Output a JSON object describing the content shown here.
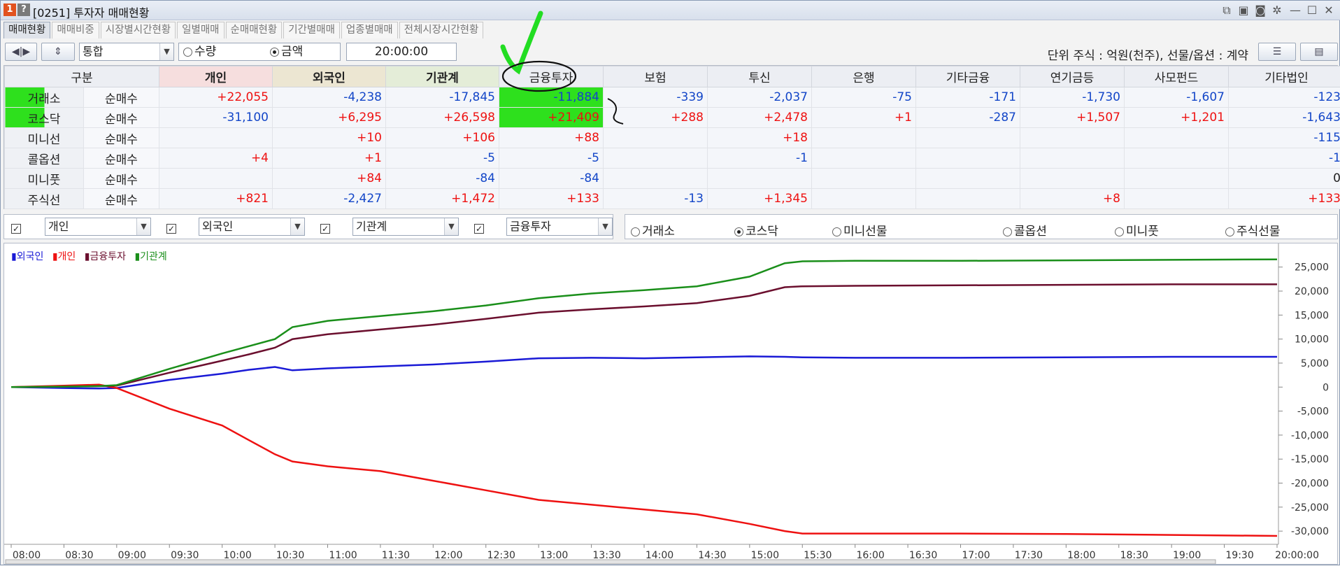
{
  "window": {
    "title": "[0251] 투자자 매매현황"
  },
  "tabs": [
    "매매현황",
    "매매비중",
    "시장별시간현황",
    "일별매매",
    "순매매현황",
    "기간별매매",
    "업종별매매",
    "전체시장시간현황"
  ],
  "toolbar": {
    "market_select": "통합",
    "radio_qty": "수량",
    "radio_amount": "금액",
    "time_value": "20:00:00",
    "unit_text": "단위 주식 : 억원(천주), 선물/옵션 : 계약"
  },
  "table": {
    "headers": [
      "구분",
      "",
      "개인",
      "외국인",
      "기관계",
      "금융투자",
      "보험",
      "투신",
      "은행",
      "기타금융",
      "연기금등",
      "사모펀드",
      "기타법인"
    ],
    "rows": [
      {
        "market": "거래소",
        "type": "순매수",
        "cells": [
          "+22,055",
          "-4,238",
          "-17,845",
          "-11,884",
          "-339",
          "-2,037",
          "-75",
          "-171",
          "-1,730",
          "-1,607",
          "-123"
        ]
      },
      {
        "market": "코스닥",
        "type": "순매수",
        "cells": [
          "-31,100",
          "+6,295",
          "+26,598",
          "+21,409",
          "+288",
          "+2,478",
          "+1",
          "-287",
          "+1,507",
          "+1,201",
          "-1,643"
        ]
      },
      {
        "market": "미니선",
        "type": "순매수",
        "cells": [
          "",
          "+10",
          "+106",
          "+88",
          "",
          "+18",
          "",
          "",
          "",
          "",
          "-115"
        ]
      },
      {
        "market": "콜옵션",
        "type": "순매수",
        "cells": [
          "+4",
          "+1",
          "-5",
          "-5",
          "",
          "-1",
          "",
          "",
          "",
          "",
          "-1"
        ]
      },
      {
        "market": "미니풋",
        "type": "순매수",
        "cells": [
          "",
          "+84",
          "-84",
          "-84",
          "",
          "",
          "",
          "",
          "",
          "",
          "0"
        ]
      },
      {
        "market": "주식선",
        "type": "순매수",
        "cells": [
          "+821",
          "-2,427",
          "+1,472",
          "+133",
          "-13",
          "+1,345",
          "",
          "",
          "+8",
          "",
          "+133"
        ]
      }
    ]
  },
  "filters": {
    "selects": [
      "개인",
      "외국인",
      "기관계",
      "금융투자"
    ],
    "radios": [
      "거래소",
      "코스닥",
      "미니선물",
      "콜옵션",
      "미니풋",
      "주식선물"
    ],
    "selected_radio": "코스닥"
  },
  "colors": {
    "foreign": "#1a1ad6",
    "individual": "#ee1111",
    "finance": "#6b0f2e",
    "institution": "#1a8f1a",
    "highlight": "#2ee01d"
  },
  "chart_data": {
    "type": "line",
    "legend": [
      "외국인",
      "개인",
      "금융투자",
      "기관계"
    ],
    "x_ticks": [
      "08:00",
      "08:30",
      "09:00",
      "09:30",
      "10:00",
      "10:30",
      "11:00",
      "11:30",
      "12:00",
      "12:30",
      "13:00",
      "13:30",
      "14:00",
      "14:30",
      "15:00",
      "15:30",
      "16:00",
      "16:30",
      "17:00",
      "17:30",
      "18:00",
      "18:30",
      "19:00",
      "19:30",
      "20:00:00"
    ],
    "y_ticks": [
      "25,000",
      "20,000",
      "15,000",
      "10,000",
      "5,000",
      "0",
      "-5,000",
      "-10,000",
      "-15,000",
      "-20,000",
      "-25,000",
      "-30,000"
    ],
    "ylim": [
      -31000,
      27000
    ],
    "x": [
      "08:00",
      "08:30",
      "08:50",
      "09:00",
      "09:30",
      "10:00",
      "10:15",
      "10:30",
      "10:40",
      "11:00",
      "11:30",
      "12:00",
      "12:30",
      "13:00",
      "13:30",
      "14:00",
      "14:30",
      "15:00",
      "15:20",
      "15:30",
      "16:00",
      "17:00",
      "18:00",
      "19:00",
      "20:00"
    ],
    "series": [
      {
        "name": "외국인",
        "values": [
          0,
          -200,
          -300,
          -200,
          1500,
          2800,
          3600,
          4200,
          3500,
          3900,
          4300,
          4700,
          5300,
          6000,
          6100,
          6000,
          6200,
          6400,
          6300,
          6200,
          6100,
          6100,
          6200,
          6300,
          6300
        ]
      },
      {
        "name": "개인",
        "values": [
          0,
          300,
          500,
          -200,
          -4500,
          -8000,
          -11000,
          -14000,
          -15500,
          -16500,
          -17500,
          -19500,
          -21500,
          -23500,
          -24500,
          -25500,
          -26500,
          -28500,
          -30000,
          -30500,
          -30500,
          -30500,
          -30600,
          -30800,
          -31000
        ]
      },
      {
        "name": "금융투자",
        "values": [
          0,
          100,
          200,
          300,
          3000,
          5500,
          6800,
          8200,
          10000,
          11000,
          12000,
          13000,
          14200,
          15500,
          16200,
          16800,
          17500,
          19000,
          20800,
          21000,
          21100,
          21200,
          21300,
          21400,
          21400
        ]
      },
      {
        "name": "기관계",
        "values": [
          0,
          100,
          200,
          400,
          3800,
          7000,
          8500,
          10000,
          12500,
          13800,
          14800,
          15800,
          17000,
          18500,
          19500,
          20200,
          21000,
          23000,
          25800,
          26200,
          26300,
          26300,
          26400,
          26500,
          26600
        ]
      }
    ]
  }
}
